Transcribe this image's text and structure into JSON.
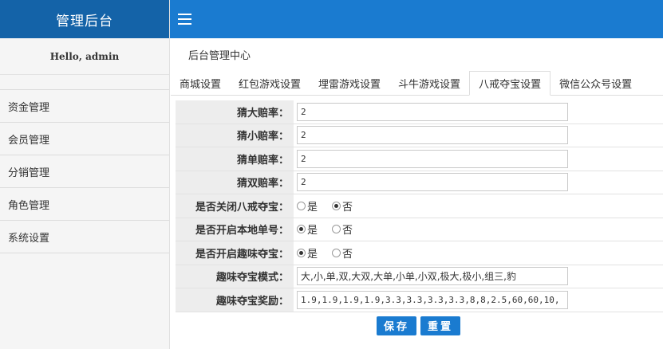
{
  "brand": {
    "title": "管理后台"
  },
  "greeting": "Hello, admin",
  "sidebar": {
    "items": [
      {
        "label": "资金管理"
      },
      {
        "label": "会员管理"
      },
      {
        "label": "分销管理"
      },
      {
        "label": "角色管理"
      },
      {
        "label": "系统设置"
      }
    ]
  },
  "topbar": {
    "menu_icon": "hamburger-icon"
  },
  "breadcrumb": "后台管理中心",
  "tabs": [
    {
      "label": "商城设置",
      "active": false
    },
    {
      "label": "红包游戏设置",
      "active": false
    },
    {
      "label": "埋雷游戏设置",
      "active": false
    },
    {
      "label": "斗牛游戏设置",
      "active": false
    },
    {
      "label": "八戒夺宝设置",
      "active": true
    },
    {
      "label": "微信公众号设置",
      "active": false
    }
  ],
  "form": {
    "guess_big": {
      "label": "猜大赔率：",
      "value": "2"
    },
    "guess_small": {
      "label": "猜小赔率：",
      "value": "2"
    },
    "guess_odd": {
      "label": "猜单赔率：",
      "value": "2"
    },
    "guess_even": {
      "label": "猜双赔率：",
      "value": "2"
    },
    "close_bajie": {
      "label": "是否关闭八戒夺宝：",
      "yes": "是",
      "no": "否",
      "selected": "no"
    },
    "local_order": {
      "label": "是否开启本地单号：",
      "yes": "是",
      "no": "否",
      "selected": "yes"
    },
    "fun_treasure": {
      "label": "是否开启趣味夺宝：",
      "yes": "是",
      "no": "否",
      "selected": "yes"
    },
    "fun_mode": {
      "label": "趣味夺宝模式：",
      "value": "大,小,单,双,大双,大单,小单,小双,极大,极小,组三,豹"
    },
    "fun_reward": {
      "label": "趣味夺宝奖励：",
      "value": "1.9,1.9,1.9,1.9,3.3,3.3,3.3,3.3,8,8,2.5,60,60,10,"
    }
  },
  "buttons": {
    "save": "保存",
    "reset": "重置"
  },
  "colors": {
    "brand_bg": "#1463a8",
    "topbar_bg": "#1a7bd0",
    "button_bg": "#1a7bd0"
  }
}
